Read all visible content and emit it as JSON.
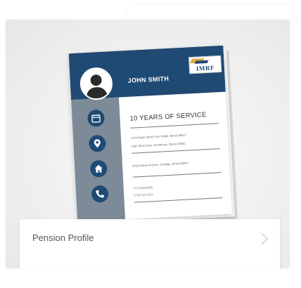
{
  "card": {
    "title": "Pension Profile",
    "chevron_icon": "chevron-right-icon"
  },
  "document": {
    "name": "JOHN SMITH",
    "logo_text": "IMRF",
    "headline": "10 YEARS OF SERVICE",
    "address_lines": [
      "1234 Eagle Street, Burr Ridge, Illinois 60527",
      "1905 West Drive, Northbrook, Illinois 60062",
      "2468 Oakwood Drive, Chicago, Illinois 60607",
      "(773) 555-5555",
      "(773) 222-1221"
    ],
    "side_icons": [
      "calendar-icon",
      "location-pin-icon",
      "home-icon",
      "phone-icon"
    ],
    "colors": {
      "header": "#1f4a73",
      "sidebar": "#7c8b97",
      "icon_bg": "#1f4a73"
    }
  }
}
